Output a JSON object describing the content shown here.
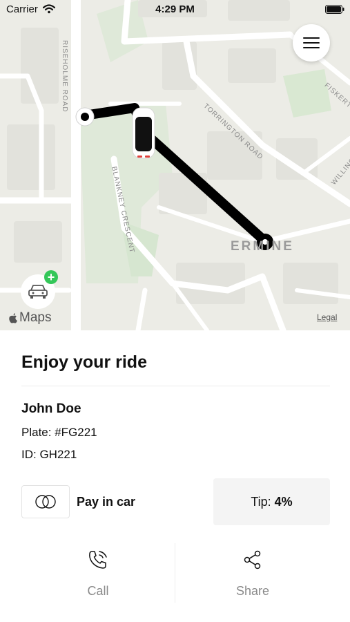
{
  "status_bar": {
    "carrier": "Carrier",
    "time": "4:29 PM"
  },
  "map": {
    "street_labels": [
      "RISEHOLME ROAD",
      "TORRINGTON ROAD",
      "BLANKNEY CRESCENT",
      "FISKERTON",
      "WILLING"
    ],
    "area_label": "ERMINE",
    "maps_brand": "Maps",
    "legal": "Legal",
    "route_color": "#000000",
    "fab_plus_color": "#34c759"
  },
  "ride": {
    "title": "Enjoy your ride",
    "driver_name": "John Doe",
    "plate": "Plate: #FG221",
    "id": "ID: GH221",
    "payment_label": "Pay in car",
    "tip_label": "Tip:",
    "tip_value": "4%"
  },
  "actions": {
    "call": "Call",
    "share": "Share"
  }
}
